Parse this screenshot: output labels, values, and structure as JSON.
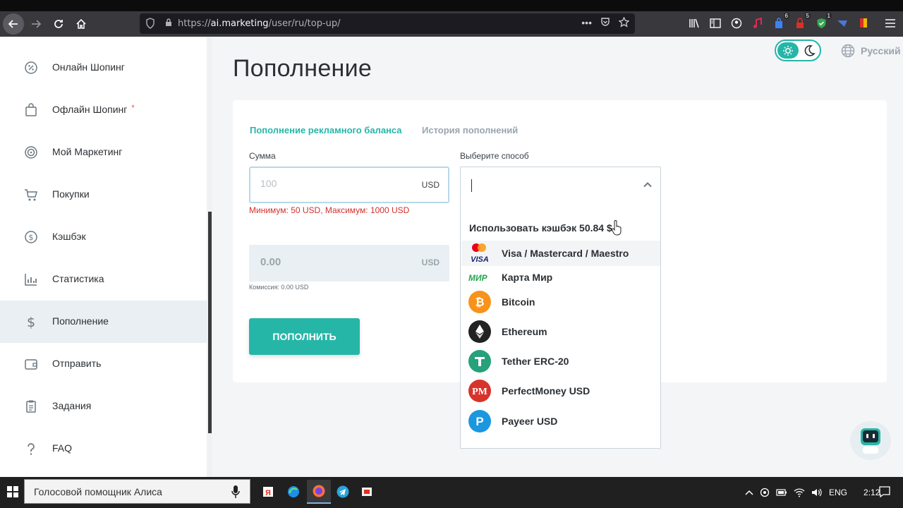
{
  "browser": {
    "url_prefix": "https://",
    "url_host": "ai.marketing",
    "url_path": "/user/ru/top-up/",
    "badges": [
      "6",
      "5",
      "1"
    ]
  },
  "sidebar": {
    "items": [
      {
        "label": "Онлайн Шопинг",
        "icon": "percent-icon"
      },
      {
        "label": "Офлайн Шопинг",
        "icon": "bag-icon",
        "star": "*"
      },
      {
        "label": "Мой Маркетинг",
        "icon": "target-icon"
      },
      {
        "label": "Покупки",
        "icon": "cart-icon"
      },
      {
        "label": "Кэшбэк",
        "icon": "coin-icon"
      },
      {
        "label": "Статистика",
        "icon": "chart-icon"
      },
      {
        "label": "Пополнение",
        "icon": "dollar-icon",
        "active": true
      },
      {
        "label": "Отправить",
        "icon": "wallet-icon"
      },
      {
        "label": "Задания",
        "icon": "clipboard-icon"
      },
      {
        "label": "FAQ",
        "icon": "question-icon"
      }
    ]
  },
  "header": {
    "title": "Пополнение",
    "language": "Русский"
  },
  "tabs": {
    "active": "Пополнение рекламного баланса",
    "inactive": "История пополнений"
  },
  "form": {
    "amount_label": "Сумма",
    "amount_placeholder": "100",
    "amount_currency": "USD",
    "amount_hint": "Минимум: 50 USD, Максимум: 1000 USD",
    "total_value": "0.00",
    "total_currency": "USD",
    "commission": "Комиссия: 0.00 USD",
    "submit_label": "ПОПОЛНИТЬ",
    "method_label": "Выберите способ"
  },
  "dropdown": {
    "cashback": "Использовать кэшбэк 50.84 $",
    "options": [
      {
        "label": "Visa / Mastercard / Maestro",
        "icon": "card-icon"
      },
      {
        "label": "Карта Мир",
        "icon": "mir-icon"
      },
      {
        "label": "Bitcoin",
        "icon": "bitcoin-icon"
      },
      {
        "label": "Ethereum",
        "icon": "ethereum-icon"
      },
      {
        "label": "Tether ERC-20",
        "icon": "tether-icon"
      },
      {
        "label": "PerfectMoney USD",
        "icon": "perfectmoney-icon"
      },
      {
        "label": "Payeer USD",
        "icon": "payeer-icon"
      }
    ]
  },
  "taskbar": {
    "search_text": "Голосовой помощник Алиса",
    "lang": "ENG",
    "time": "2:12"
  },
  "colors": {
    "accent": "#26b6a8",
    "error": "#d0312d"
  }
}
